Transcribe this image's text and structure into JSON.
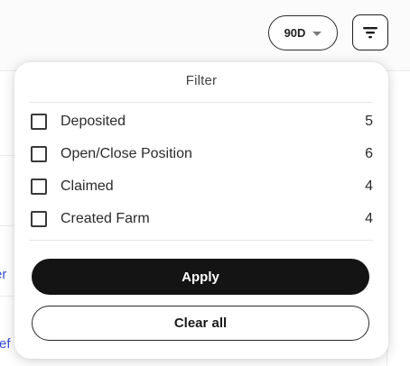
{
  "toolbar": {
    "range_value": "90D",
    "range_icon": "chevron-down-icon",
    "filter_icon": "filter-icon"
  },
  "background": {
    "link_fragment_1": "er",
    "link_fragment_2": "ref",
    "link_color": "#3a4fd8"
  },
  "filter": {
    "title": "Filter",
    "options": [
      {
        "label": "Deposited",
        "count": "5",
        "checked": false
      },
      {
        "label": "Open/Close Position",
        "count": "6",
        "checked": false
      },
      {
        "label": "Claimed",
        "count": "4",
        "checked": false
      },
      {
        "label": "Created Farm",
        "count": "4",
        "checked": false
      }
    ],
    "apply_label": "Apply",
    "clear_label": "Clear all"
  }
}
